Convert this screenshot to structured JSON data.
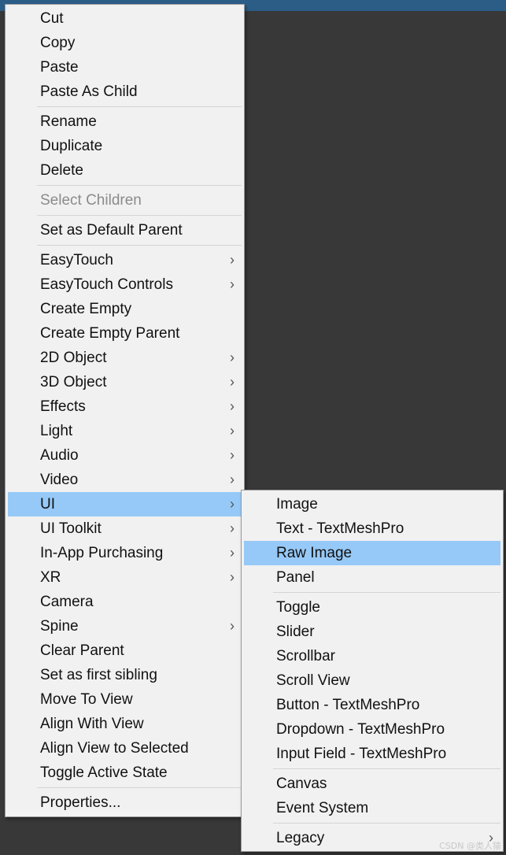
{
  "main_menu": {
    "items": [
      {
        "label": "Cut"
      },
      {
        "label": "Copy"
      },
      {
        "label": "Paste"
      },
      {
        "label": "Paste As Child"
      },
      {
        "label": "Rename"
      },
      {
        "label": "Duplicate"
      },
      {
        "label": "Delete"
      },
      {
        "label": "Select Children",
        "disabled": true
      },
      {
        "label": "Set as Default Parent"
      },
      {
        "label": "EasyTouch",
        "submenu": true
      },
      {
        "label": "EasyTouch Controls",
        "submenu": true
      },
      {
        "label": "Create Empty"
      },
      {
        "label": "Create Empty Parent"
      },
      {
        "label": "2D Object",
        "submenu": true
      },
      {
        "label": "3D Object",
        "submenu": true
      },
      {
        "label": "Effects",
        "submenu": true
      },
      {
        "label": "Light",
        "submenu": true
      },
      {
        "label": "Audio",
        "submenu": true
      },
      {
        "label": "Video",
        "submenu": true
      },
      {
        "label": "UI",
        "submenu": true,
        "highlighted": true
      },
      {
        "label": "UI Toolkit",
        "submenu": true
      },
      {
        "label": "In-App Purchasing",
        "submenu": true
      },
      {
        "label": "XR",
        "submenu": true
      },
      {
        "label": "Camera"
      },
      {
        "label": "Spine",
        "submenu": true
      },
      {
        "label": "Clear Parent"
      },
      {
        "label": "Set as first sibling"
      },
      {
        "label": "Move To View"
      },
      {
        "label": "Align With View"
      },
      {
        "label": "Align View to Selected"
      },
      {
        "label": "Toggle Active State"
      },
      {
        "label": "Properties..."
      }
    ]
  },
  "sub_menu": {
    "items": [
      {
        "label": "Image"
      },
      {
        "label": "Text - TextMeshPro"
      },
      {
        "label": "Raw Image",
        "highlighted": true
      },
      {
        "label": "Panel"
      },
      {
        "label": "Toggle"
      },
      {
        "label": "Slider"
      },
      {
        "label": "Scrollbar"
      },
      {
        "label": "Scroll View"
      },
      {
        "label": "Button - TextMeshPro"
      },
      {
        "label": "Dropdown - TextMeshPro"
      },
      {
        "label": "Input Field - TextMeshPro"
      },
      {
        "label": "Canvas"
      },
      {
        "label": "Event System"
      },
      {
        "label": "Legacy",
        "submenu": true
      }
    ]
  },
  "submenu_arrow_glyph": "›",
  "watermark_text": "CSDN @类人猿",
  "colors": {
    "menu_bg": "#f1f1f1",
    "highlight": "#96c9f7",
    "disabled_text": "#8b8b8b",
    "backdrop": "#383838",
    "title_bar": "#2c5d87"
  }
}
